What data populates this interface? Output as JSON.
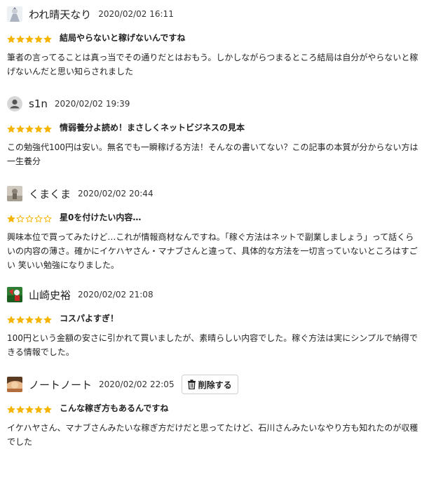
{
  "reviews": [
    {
      "name": "われ晴天なり",
      "date": "2020/02/02 16:11",
      "rating": 5,
      "title": "結局やらないと稼げないんですね",
      "body": "筆者の言ってることは真っ当でその通りだとはおもう。しかしながらつまるところ結局は自分がやらないと稼げないんだと思い知らされました"
    },
    {
      "name": "s1n",
      "date": "2020/02/02 19:39",
      "rating": 5,
      "title": "情弱養分よ読め！まさしくネットビジネスの見本",
      "body": "この勉強代100円は安い。無名でも一瞬稼げる方法！そんなの書いてない？この記事の本質が分からない方は一生養分"
    },
    {
      "name": "くまくま",
      "date": "2020/02/02 20:44",
      "rating": 1,
      "title": "星0を付けたい内容…",
      "body": "興味本位で買ってみたけど…これが情報商材なんですね。「稼ぐ方法はネットで副業しましょう」って話くらいの内容の薄さ。確かにイケハヤさん・マナブさんと違って、具体的な方法を一切言っていないところはすごい 笑いい勉強になりました。"
    },
    {
      "name": "山崎史裕",
      "date": "2020/02/02 21:08",
      "rating": 5,
      "title": "コスパよすぎ！",
      "body": "100円という金額の安さに引かれて買いましたが、素晴らしい内容でした。稼ぐ方法は実にシンプルで納得できる情報でした。"
    },
    {
      "name": "ノートノート",
      "date": "2020/02/02 22:05",
      "rating": 5,
      "title": "こんな稼ぎ方もあるんですね",
      "body": "イケハヤさん、マナブさんみたいな稼ぎ方だけだと思ってたけど、石川さんみたいなやり方も知れたのが収穫でした",
      "delete_label": "削除する"
    }
  ],
  "colors": {
    "star": "#f4b400",
    "text": "#222222"
  }
}
